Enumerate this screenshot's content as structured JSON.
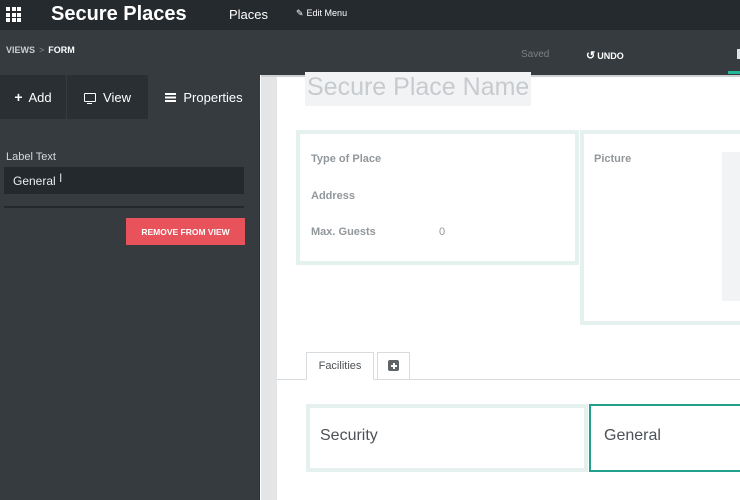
{
  "navbar": {
    "app_title": "Secure Places",
    "menu_places": "Places",
    "edit_menu": "Edit Menu"
  },
  "subbar": {
    "breadcrumb_views": "VIEWS",
    "breadcrumb_sep": ">",
    "breadcrumb_form": "FORM",
    "saved": "Saved",
    "undo": "UNDO"
  },
  "sidebar": {
    "tabs": {
      "add": "Add",
      "view": "View",
      "properties": "Properties"
    },
    "label_text_caption": "Label Text",
    "label_text_value": "General",
    "remove_button": "REMOVE FROM VIEW"
  },
  "form": {
    "record_title_placeholder": "Secure Place Name",
    "fields": {
      "type_of_place": "Type of Place",
      "address": "Address",
      "max_guests": "Max. Guests",
      "max_guests_value": "0",
      "picture": "Picture"
    },
    "notebook": {
      "tab_facilities": "Facilities"
    },
    "tab_content": {
      "security": "Security",
      "general": "General"
    }
  },
  "colors": {
    "navbar_bg": "#252a2e",
    "sidebar_bg": "#353b3f",
    "remove_button_bg": "#e7525b",
    "accent_teal": "#21a08d",
    "group_border": "#e4f1ef"
  }
}
